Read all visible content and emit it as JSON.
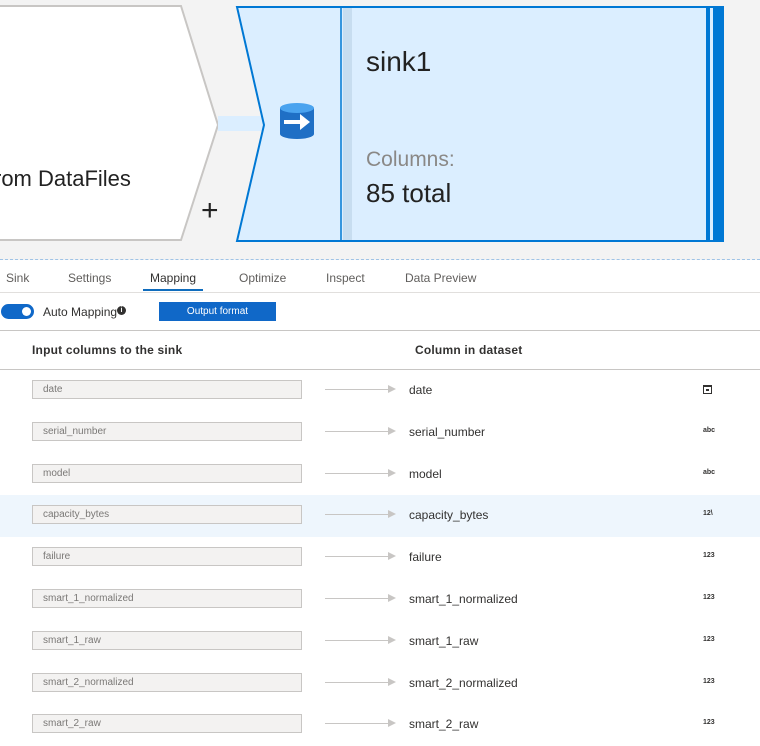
{
  "canvas": {
    "source_label": "rom DataFiles",
    "add_label": "+",
    "sink": {
      "name": "sink1",
      "columns_label": "Columns:",
      "columns_total": "85 total"
    }
  },
  "tabs": [
    {
      "label": "Sink",
      "active": false
    },
    {
      "label": "Settings",
      "active": false
    },
    {
      "label": "Mapping",
      "active": true
    },
    {
      "label": "Optimize",
      "active": false
    },
    {
      "label": "Inspect",
      "active": false
    },
    {
      "label": "Data Preview",
      "active": false
    }
  ],
  "toolbar": {
    "auto_mapping_label": "Auto Mapping",
    "auto_mapping_on": true,
    "info_icon": "info-icon",
    "output_format_label": "Output format"
  },
  "table": {
    "headers": {
      "input": "Input columns to the sink",
      "output": "Column in dataset"
    },
    "rows": [
      {
        "input": "date",
        "output": "date",
        "type_icon": "calendar-icon",
        "type_label": ""
      },
      {
        "input": "serial_number",
        "output": "serial_number",
        "type_icon": "string-type-icon",
        "type_label": "abc"
      },
      {
        "input": "model",
        "output": "model",
        "type_icon": "string-type-icon",
        "type_label": "abc"
      },
      {
        "input": "capacity_bytes",
        "output": "capacity_bytes",
        "type_icon": "decimal-type-icon",
        "type_label": "12\\",
        "highlighted": true
      },
      {
        "input": "failure",
        "output": "failure",
        "type_icon": "integer-type-icon",
        "type_label": "123"
      },
      {
        "input": "smart_1_normalized",
        "output": "smart_1_normalized",
        "type_icon": "integer-type-icon",
        "type_label": "123"
      },
      {
        "input": "smart_1_raw",
        "output": "smart_1_raw",
        "type_icon": "integer-type-icon",
        "type_label": "123"
      },
      {
        "input": "smart_2_normalized",
        "output": "smart_2_normalized",
        "type_icon": "integer-type-icon",
        "type_label": "123"
      },
      {
        "input": "smart_2_raw",
        "output": "smart_2_raw",
        "type_icon": "integer-type-icon",
        "type_label": "123"
      }
    ]
  },
  "colors": {
    "accent": "#1068c8",
    "sink_fill": "#dbeeff",
    "sink_border": "#0078d4",
    "row_highlight": "#eef6fd"
  }
}
